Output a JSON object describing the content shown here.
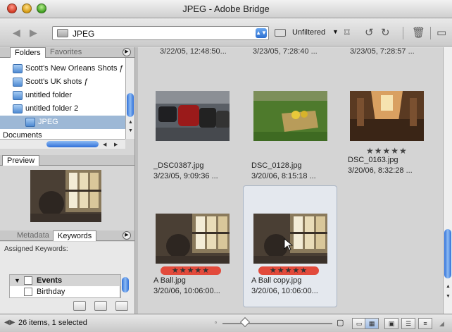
{
  "window": {
    "title": "JPEG - Adobe Bridge"
  },
  "toolbar": {
    "back_icon": "back-arrow-icon",
    "forward_icon": "forward-arrow-icon",
    "path": "JPEG",
    "filter_label": "Unfiltered"
  },
  "left_panel": {
    "folder_tabs": [
      "Folders",
      "Favorites"
    ],
    "folders": [
      {
        "label": "Scott's New Orleans Shots ƒ",
        "level": 0,
        "selected": false
      },
      {
        "label": "Scott's UK shots ƒ",
        "level": 0,
        "selected": false
      },
      {
        "label": "untitled folder",
        "level": 0,
        "selected": false
      },
      {
        "label": "untitled folder 2",
        "level": 0,
        "selected": false
      },
      {
        "label": "JPEG",
        "level": 1,
        "selected": true
      },
      {
        "label": "Documents",
        "level": -1,
        "selected": false
      }
    ],
    "preview_tab": "Preview",
    "meta_tabs": [
      "Metadata",
      "Keywords"
    ],
    "assigned_keywords_label": "Assigned Keywords:",
    "keywords": [
      {
        "label": "Events",
        "group": true
      },
      {
        "label": "Birthday",
        "group": false
      }
    ]
  },
  "content": {
    "top_row_partial": [
      "3/22/05, 12:48:50...",
      "3/23/05, 7:28:40 ...",
      "3/23/05, 7:28:57 ..."
    ],
    "items": [
      {
        "name": "_DSC0387.jpg",
        "date": "3/23/05, 9:09:36 ...",
        "stars": "",
        "label": ""
      },
      {
        "name": "DSC_0128.jpg",
        "date": "3/20/06, 8:15:18 ...",
        "stars": "",
        "label": ""
      },
      {
        "name": "DSC_0163.jpg",
        "date": "3/20/06, 8:32:28 ...",
        "stars": "★★★★★",
        "label": ""
      },
      {
        "name": "A Ball.jpg",
        "date": "3/20/06, 10:06:00...",
        "stars": "★★★★★",
        "label": "red"
      },
      {
        "name": "A Ball copy.jpg",
        "date": "3/20/06, 10:06:00...",
        "stars": "★★★★★",
        "label": "red",
        "selected": true
      }
    ]
  },
  "status": {
    "text": "26 items, 1 selected"
  }
}
